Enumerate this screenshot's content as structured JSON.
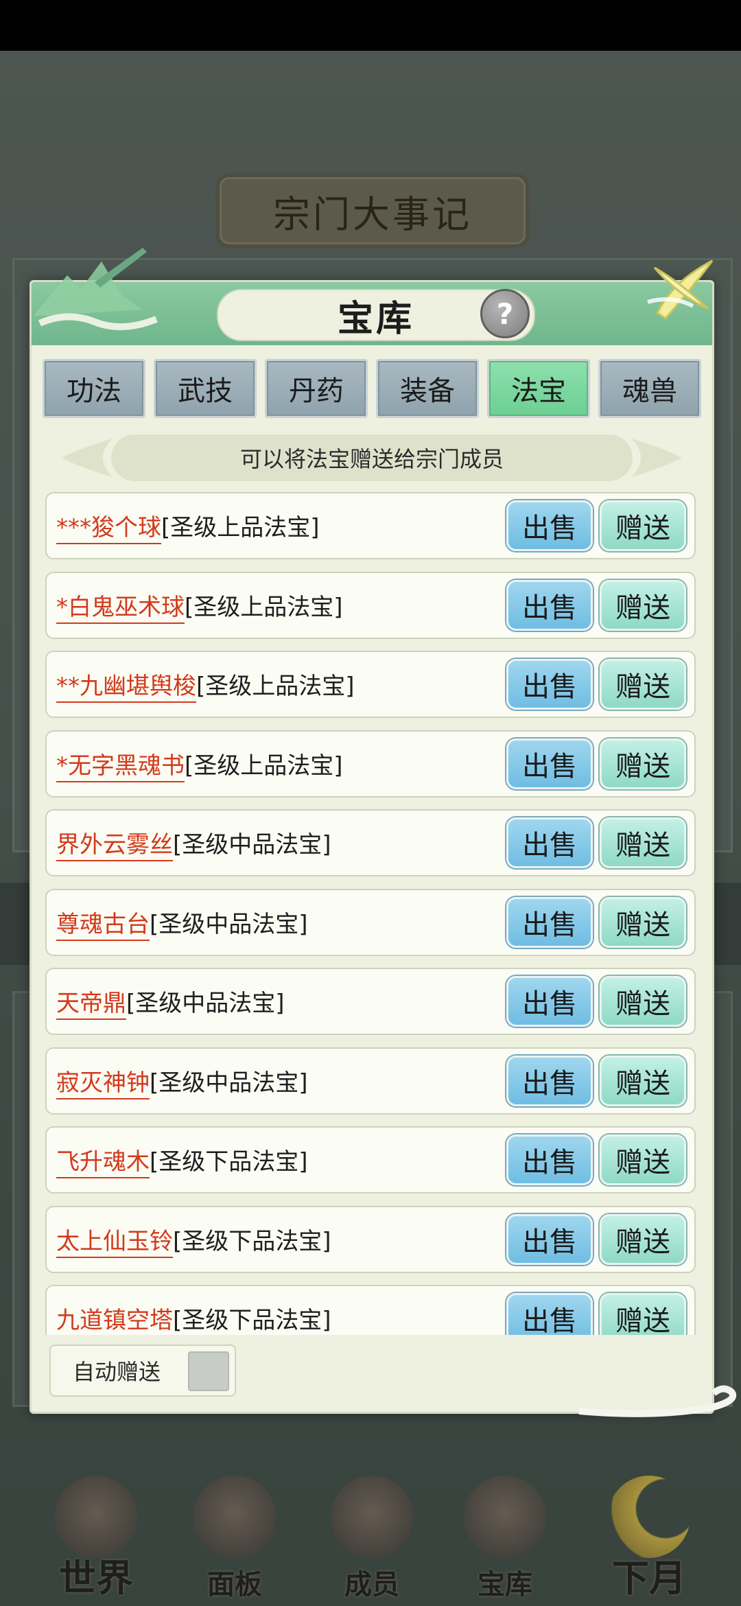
{
  "background": {
    "banner_title": "宗门大事记",
    "bottom_nav": [
      {
        "label": "世界",
        "icon": "world-gate-icon"
      },
      {
        "label": "面板",
        "icon": "panel-hall-icon"
      },
      {
        "label": "成员",
        "icon": "member-figure-icon"
      },
      {
        "label": "宝库",
        "icon": "treasury-pagoda-icon"
      },
      {
        "label": "下月",
        "icon": "moon-icon"
      }
    ]
  },
  "modal": {
    "title": "宝库",
    "help": "?",
    "tabs": [
      {
        "label": "功法",
        "active": false
      },
      {
        "label": "武技",
        "active": false
      },
      {
        "label": "丹药",
        "active": false
      },
      {
        "label": "装备",
        "active": false
      },
      {
        "label": "法宝",
        "active": true
      },
      {
        "label": "魂兽",
        "active": false
      }
    ],
    "hint": "可以将法宝赠送给宗门成员",
    "items": [
      {
        "name": "***狻个球",
        "grade": "[圣级上品法宝]"
      },
      {
        "name": "*白鬼巫术球",
        "grade": "[圣级上品法宝]"
      },
      {
        "name": "**九幽堪舆梭",
        "grade": "[圣级上品法宝]"
      },
      {
        "name": "*无字黑魂书",
        "grade": "[圣级上品法宝]"
      },
      {
        "name": "界外云雾丝",
        "grade": "[圣级中品法宝]"
      },
      {
        "name": "尊魂古台",
        "grade": "[圣级中品法宝]"
      },
      {
        "name": "天帝鼎",
        "grade": "[圣级中品法宝]"
      },
      {
        "name": "寂灭神钟",
        "grade": "[圣级中品法宝]"
      },
      {
        "name": "飞升魂木",
        "grade": "[圣级下品法宝]"
      },
      {
        "name": "太上仙玉铃",
        "grade": "[圣级下品法宝]"
      },
      {
        "name": "九道镇空塔",
        "grade": "[圣级下品法宝]"
      }
    ],
    "sell_label": "出售",
    "gift_label": "赠送",
    "auto_gift_label": "自动赠送",
    "auto_gift_checked": false
  },
  "colors": {
    "item_name": "#d33a1b",
    "header_green": "#7cbf95",
    "active_tab": "#7ad79e"
  }
}
